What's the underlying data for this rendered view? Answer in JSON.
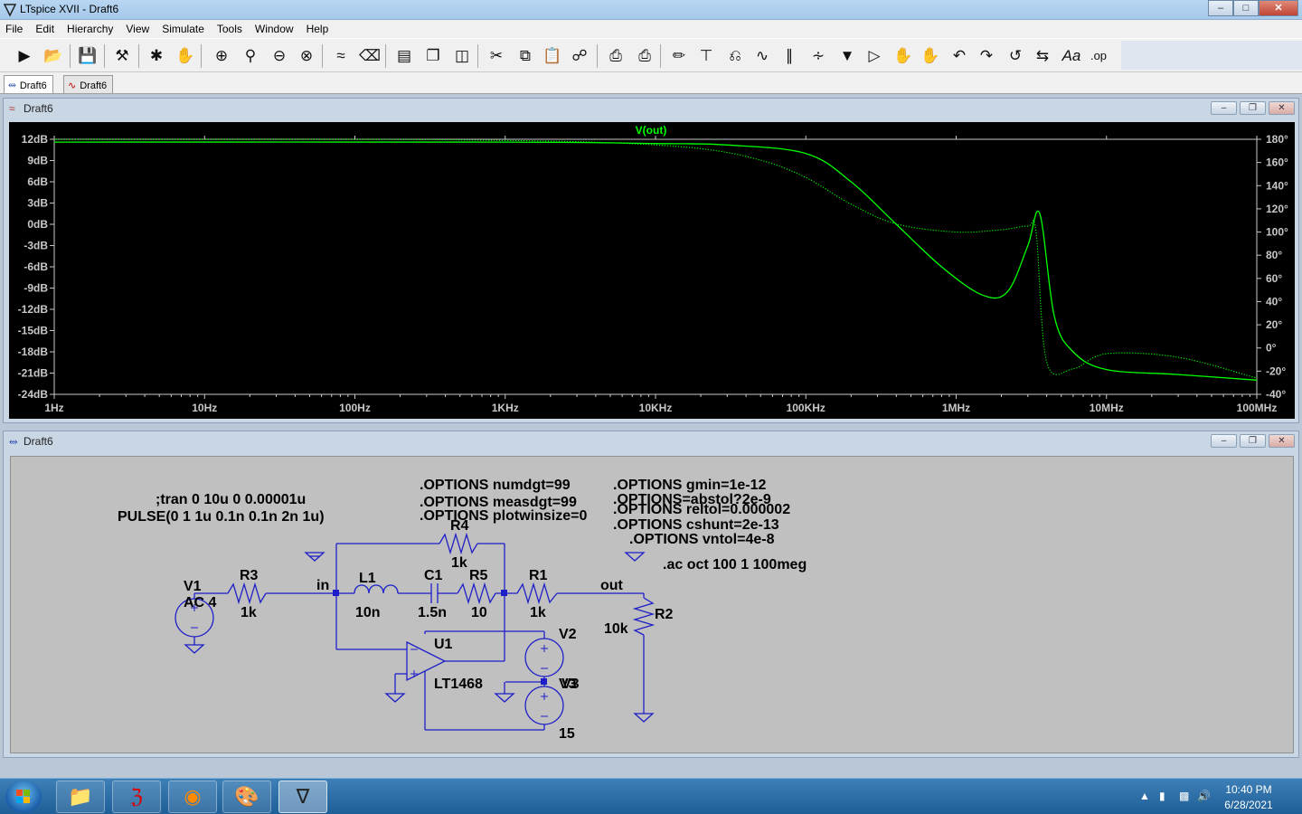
{
  "window": {
    "title": "LTspice XVII - Draft6",
    "minimize": "‒",
    "maximize": "□",
    "close": "✕"
  },
  "menu": [
    "File",
    "Edit",
    "Hierarchy",
    "View",
    "Simulate",
    "Tools",
    "Window",
    "Help"
  ],
  "toolbar_icons": [
    "run-icon",
    "open-icon",
    "save-icon",
    "control-panel-icon",
    "halt-icon",
    "pan-icon",
    "zoom-in-icon",
    "zoom-area-icon",
    "zoom-out-icon",
    "zoom-fit-icon",
    "autorange-icon",
    "delete-trace-icon",
    "tile-horizontal-icon",
    "cascade-icon",
    "tile-vertical-icon",
    "cut-icon",
    "copy-icon",
    "paste-icon",
    "find-icon",
    "print-icon",
    "print-setup-icon",
    "pencil-icon",
    "ground-icon",
    "label-net-icon",
    "resistor-icon",
    "capacitor-icon",
    "inductor-icon",
    "diode-icon",
    "component-icon",
    "move-icon",
    "drag-icon",
    "undo-icon",
    "redo-icon",
    "rotate-icon",
    "mirror-icon",
    "text-icon",
    "spice-directive-icon"
  ],
  "tabs": [
    {
      "label": "Draft6",
      "icon": "schematic-icon",
      "active": true
    },
    {
      "label": "Draft6",
      "icon": "waveform-icon",
      "active": false
    }
  ],
  "plot_window": {
    "title": "Draft6",
    "trace_label": "V(out)",
    "trace_color": "#00ff00"
  },
  "chart_data": {
    "type": "line",
    "title": "",
    "xscale": "log",
    "xlim": [
      1,
      100000000
    ],
    "ylim_left": [
      -24,
      12
    ],
    "ylim_right": [
      -40,
      180
    ],
    "x_tick_labels": [
      "1Hz",
      "10Hz",
      "100Hz",
      "1KHz",
      "10KHz",
      "100KHz",
      "1MHz",
      "10MHz",
      "100MHz"
    ],
    "y_left_tick_labels": [
      "12dB",
      "9dB",
      "6dB",
      "3dB",
      "0dB",
      "-3dB",
      "-6dB",
      "-9dB",
      "-12dB",
      "-15dB",
      "-18dB",
      "-21dB",
      "-24dB"
    ],
    "y_right_tick_labels": [
      "180°",
      "160°",
      "140°",
      "120°",
      "100°",
      "80°",
      "60°",
      "40°",
      "20°",
      "0°",
      "-20°",
      "-40°"
    ],
    "series": [
      {
        "name": "V(out)",
        "style": "solid",
        "axis": "left-dB",
        "x": [
          1,
          1000,
          10000,
          30000,
          100000,
          200000,
          400000,
          800000,
          1500000,
          2200000,
          3000000,
          3600000,
          4500000,
          6000000,
          10000000,
          30000000,
          100000000
        ],
        "y": [
          11.6,
          11.6,
          11.4,
          11.2,
          10.0,
          6.0,
          0.0,
          -6.0,
          -10.0,
          -9.5,
          -3.0,
          1.5,
          -13.0,
          -18.0,
          -20.5,
          -21.2,
          -22.0
        ]
      },
      {
        "name": "V(out) phase",
        "style": "dotted",
        "axis": "right-deg",
        "x": [
          1,
          100,
          1000,
          5000,
          20000,
          50000,
          100000,
          200000,
          400000,
          1000000,
          2000000,
          3000000,
          3400000,
          4000000,
          6000000,
          10000000,
          30000000,
          100000000
        ],
        "y": [
          180,
          180,
          179,
          177,
          172,
          162,
          147,
          124,
          107,
          100,
          102,
          105,
          100,
          -12,
          -18,
          -5,
          -8,
          -26
        ]
      }
    ]
  },
  "schematic_window": {
    "title": "Draft6",
    "directives": {
      "tran": ";tran 0 10u 0 0.00001u",
      "pulse": "PULSE(0 1 1u 0.1n 0.1n 2n 1u)",
      "opt1": ".OPTIONS numdgt=99",
      "opt2": ".OPTIONS measdgt=99",
      "opt3": ".OPTIONS plotwinsize=0",
      "opt4": ".OPTIONS gmin=1e-12",
      "opt5": ".OPTIONS=abstol?2e-9",
      "opt6": ".OPTIONS reltol=0.000002",
      "opt7": ".OPTIONS cshunt=2e-13",
      "opt8": ".OPTIONS vntol=4e-8",
      "ac": ".ac oct 100 1 100meg"
    },
    "components": {
      "V1": {
        "name": "V1",
        "value": "AC 4"
      },
      "R3": {
        "name": "R3",
        "value": "1k"
      },
      "L1": {
        "name": "L1",
        "value": "10n"
      },
      "C1": {
        "name": "C1",
        "value": "1.5n"
      },
      "R5": {
        "name": "R5",
        "value": "10"
      },
      "R1": {
        "name": "R1",
        "value": "1k"
      },
      "R4": {
        "name": "R4",
        "value": "1k"
      },
      "R2": {
        "name": "R2",
        "value": "10k"
      },
      "U1": {
        "name": "U1",
        "value": "LT1468"
      },
      "V2": {
        "name": "V2"
      },
      "V3": {
        "name": "V3",
        "value": "15",
        "overlap_label": "V3"
      }
    },
    "nets": {
      "in": "in",
      "out": "out"
    }
  },
  "taskbar": {
    "apps": [
      {
        "name": "explorer",
        "icon": "folder-icon"
      },
      {
        "name": "acrobat",
        "icon": "acrobat-icon"
      },
      {
        "name": "firefox",
        "icon": "firefox-icon"
      },
      {
        "name": "paint",
        "icon": "paint-icon"
      },
      {
        "name": "ltspice",
        "icon": "ltspice-icon",
        "active": true
      }
    ],
    "time": "10:40 PM",
    "date": "6/28/2021"
  }
}
